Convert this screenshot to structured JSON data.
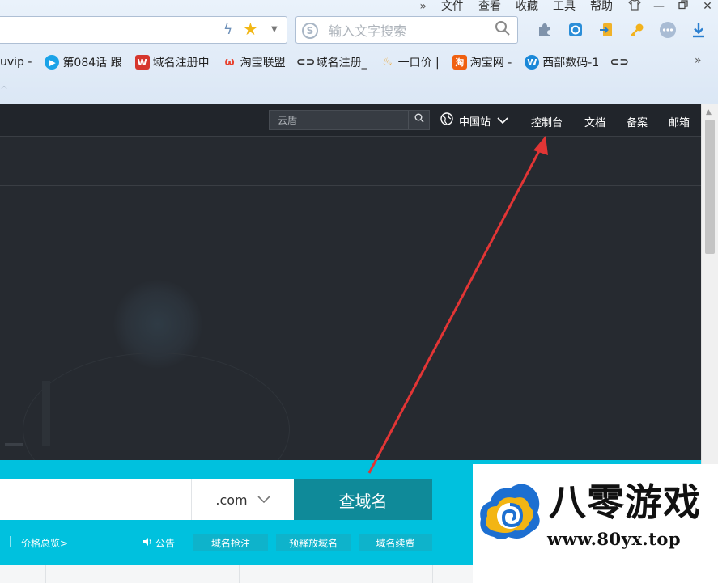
{
  "browser": {
    "menu": [
      "文件",
      "查看",
      "收藏",
      "工具",
      "帮助"
    ],
    "menu_more": "»",
    "window_controls": [
      "shirt-icon",
      "minimize-icon",
      "restore-icon",
      "close-icon"
    ],
    "search_placeholder": "输入文字搜索",
    "toolbar_icons": [
      "puzzle-icon",
      "capture-icon",
      "login-icon",
      "key-icon",
      "more-icon",
      "download-icon"
    ],
    "bookmarks": [
      {
        "label": "uvip -",
        "icon": "none",
        "color": ""
      },
      {
        "label": "第084话 跟",
        "icon": "play-icon",
        "color": "#1aa3e8"
      },
      {
        "label": "域名注册申",
        "icon": "domain-icon",
        "color": "#d6372e"
      },
      {
        "label": "淘宝联盟",
        "icon": "taobao-union-icon",
        "color": "#e8432f"
      },
      {
        "label": "域名注册_",
        "icon": "link-icon",
        "color": "#333333"
      },
      {
        "label": "一口价 |",
        "icon": "fire-icon",
        "color": "#f0a020"
      },
      {
        "label": "淘宝网 -",
        "icon": "taobao-icon",
        "color": "#f06010"
      },
      {
        "label": "西部数码-1",
        "icon": "west-digital-icon",
        "color": "#1a88d8"
      }
    ],
    "bookmarks_more": "»"
  },
  "page": {
    "topnav": {
      "search_placeholder": "云盾",
      "region": "中国站",
      "links": [
        "控制台",
        "文档",
        "备案",
        "邮箱"
      ]
    },
    "domain_search": {
      "suffix": ".com",
      "button": "查域名",
      "price_link": "价格总览>",
      "notice": "公告",
      "pills": [
        "域名抢注",
        "预释放域名",
        "域名续费"
      ]
    }
  },
  "watermark": {
    "name": "八零游戏",
    "url": "www.80yx.top"
  },
  "colors": {
    "accent": "#00c1de",
    "button": "#0f8a99",
    "page_bg": "#262a30",
    "arrow": "#e23535"
  }
}
